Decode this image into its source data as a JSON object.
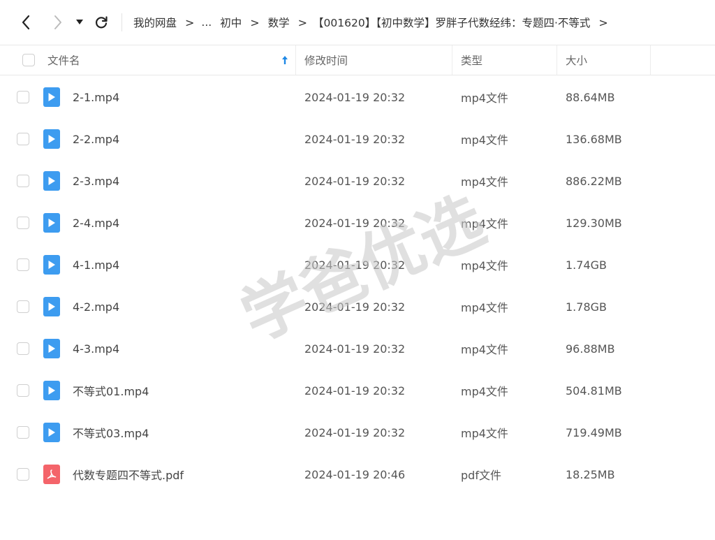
{
  "toolbar": {
    "breadcrumbs": [
      "我的网盘",
      "...",
      "初中",
      "数学",
      "【001620】【初中数学】罗胖子代数经纬：专题四·不等式"
    ]
  },
  "table": {
    "columns": {
      "name": "文件名",
      "modified": "修改时间",
      "type": "类型",
      "size": "大小"
    },
    "rows": [
      {
        "name": "2-1.mp4",
        "modified": "2024-01-19 20:32",
        "type": "mp4文件",
        "size": "88.64MB",
        "kind": "video"
      },
      {
        "name": "2-2.mp4",
        "modified": "2024-01-19 20:32",
        "type": "mp4文件",
        "size": "136.68MB",
        "kind": "video"
      },
      {
        "name": "2-3.mp4",
        "modified": "2024-01-19 20:32",
        "type": "mp4文件",
        "size": "886.22MB",
        "kind": "video"
      },
      {
        "name": "2-4.mp4",
        "modified": "2024-01-19 20:32",
        "type": "mp4文件",
        "size": "129.30MB",
        "kind": "video"
      },
      {
        "name": "4-1.mp4",
        "modified": "2024-01-19 20:32",
        "type": "mp4文件",
        "size": "1.74GB",
        "kind": "video"
      },
      {
        "name": "4-2.mp4",
        "modified": "2024-01-19 20:32",
        "type": "mp4文件",
        "size": "1.78GB",
        "kind": "video"
      },
      {
        "name": "4-3.mp4",
        "modified": "2024-01-19 20:32",
        "type": "mp4文件",
        "size": "96.88MB",
        "kind": "video"
      },
      {
        "name": "不等式01.mp4",
        "modified": "2024-01-19 20:32",
        "type": "mp4文件",
        "size": "504.81MB",
        "kind": "video"
      },
      {
        "name": "不等式03.mp4",
        "modified": "2024-01-19 20:32",
        "type": "mp4文件",
        "size": "719.49MB",
        "kind": "video"
      },
      {
        "name": "代数专题四不等式.pdf",
        "modified": "2024-01-19 20:46",
        "type": "pdf文件",
        "size": "18.25MB",
        "kind": "pdf"
      }
    ]
  },
  "watermark": {
    "text": "学爸优选"
  },
  "colors": {
    "accent": "#3d9cf0",
    "pdf": "#f4646a",
    "sort_arrow": "#1e88e5"
  }
}
